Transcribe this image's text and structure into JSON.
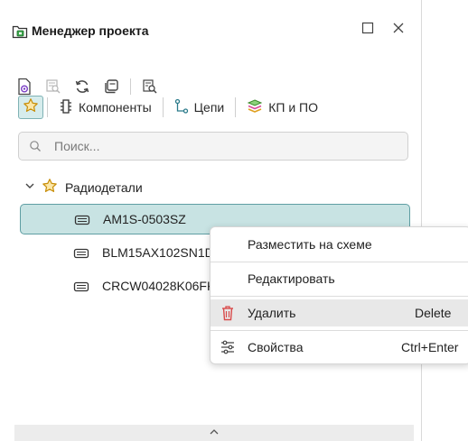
{
  "window": {
    "title": "Менеджер проекта",
    "icons": {
      "app": "project-manager-icon",
      "maximize": "maximize-icon",
      "close": "close-icon"
    }
  },
  "toolbar": {
    "icons": [
      "document-preview-icon",
      "find-in-schematic-icon",
      "refresh-icon",
      "copy-icon",
      "find-in-pcb-icon"
    ]
  },
  "tabs": {
    "favorites": "favorites-star-icon",
    "items": [
      {
        "label": "Компоненты",
        "icon": "component-icon"
      },
      {
        "label": "Цепи",
        "icon": "net-icon"
      },
      {
        "label": "КП и ПО",
        "icon": "pad-stack-icon"
      }
    ]
  },
  "search": {
    "placeholder": "Поиск...",
    "value": ""
  },
  "tree": {
    "group": {
      "label": "Радиодетали",
      "expanded": true
    },
    "items": [
      {
        "label": "AM1S-0503SZ",
        "selected": true
      },
      {
        "label": "BLM15AX102SN1D",
        "selected": false
      },
      {
        "label": "CRCW04028K06FKED",
        "selected": false
      }
    ]
  },
  "context_menu": {
    "items": [
      {
        "label": "Разместить на схеме",
        "shortcut": "",
        "icon": ""
      },
      {
        "label": "Редактировать",
        "shortcut": "",
        "icon": ""
      },
      {
        "label": "Удалить",
        "shortcut": "Delete",
        "icon": "trash-icon"
      },
      {
        "label": "Свойства",
        "shortcut": "Ctrl+Enter",
        "icon": "settings-sliders-icon"
      }
    ]
  },
  "colors": {
    "accent": "#5f9ea3",
    "selection_bg": "#c8e3e3",
    "star": "#e6a817",
    "delete_red": "#d94a4a"
  }
}
